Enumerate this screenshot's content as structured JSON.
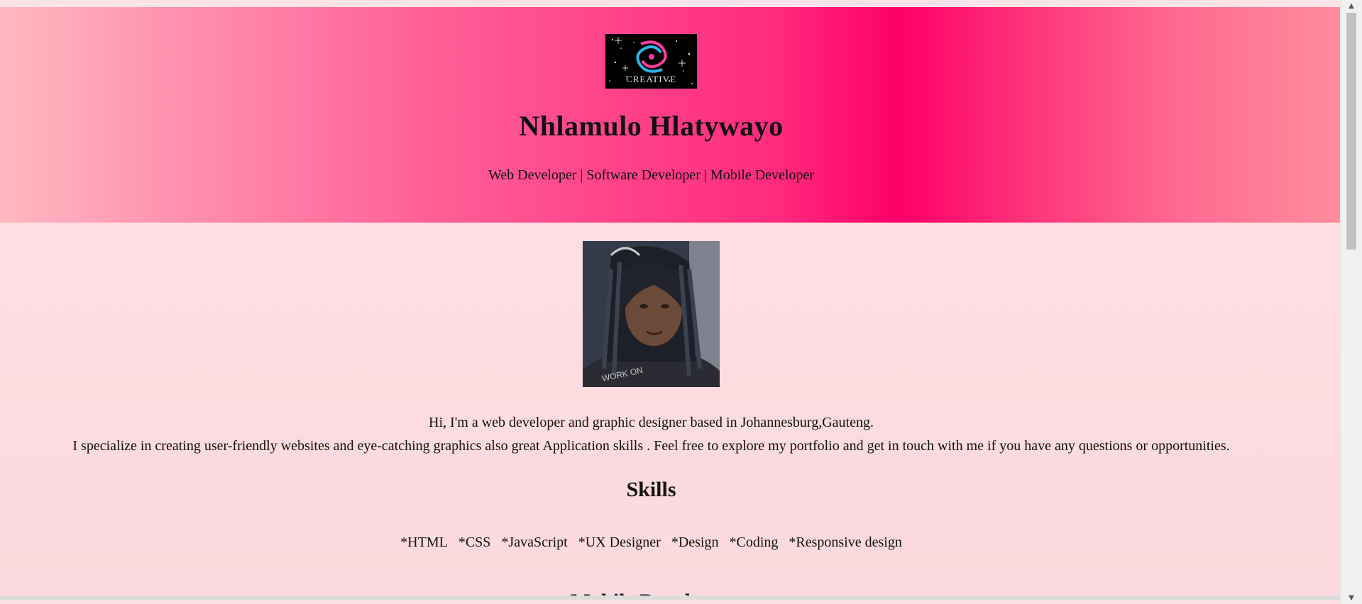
{
  "header": {
    "logo_text": "CREATIVE",
    "name": "Nhlamulo Hlatywayo",
    "roles": "Web Developer | Software Developer | Mobile Developer"
  },
  "profile": {
    "shirt_text": "WORK ON"
  },
  "intro": {
    "line1": "Hi, I'm a web developer and graphic designer based in Johannesburg,Gauteng.",
    "line2": "I specialize in creating user-friendly websites and eye-catching graphics also great Application skills . Feel free to explore my portfolio and get in touch with me if you have any questions or opportunities."
  },
  "skills": {
    "title": "Skills",
    "items": [
      "*HTML",
      "*CSS",
      "*JavaScript",
      "*UX Designer",
      "*Design",
      "*Coding",
      "*Responsive design"
    ]
  },
  "next_section": {
    "title": "Mobile Developer"
  },
  "scrollbar": {
    "up_arrow": "▲",
    "down_arrow": "▼"
  },
  "colors": {
    "hero_gradient_start": "#ffb8c0",
    "hero_gradient_peak": "#fd0068",
    "page_background": "#fde1e4",
    "logo_background": "#000000"
  }
}
